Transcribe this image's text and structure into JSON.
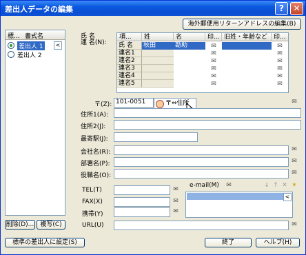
{
  "window": {
    "title": "差出人データの編集",
    "help_btn": "?",
    "close_btn": "✕"
  },
  "top_button": "海外郵便用リターンアドレスの編集(B)",
  "left_list": {
    "headers": [
      "標...",
      "書式名"
    ],
    "items": [
      {
        "label": "差出人 1",
        "selected": true
      },
      {
        "label": "差出人 2",
        "selected": false
      }
    ],
    "delete_btn": "削除(D)...",
    "copy_btn": "複写(C)"
  },
  "name_section": {
    "label_line1": "氏 名",
    "label_line2": "連 名(N):",
    "columns": [
      "項...",
      "姓",
      "名",
      "印...",
      "旧姓・年齢など",
      "印..."
    ],
    "rows": [
      {
        "item": "氏 名",
        "sei": "秋田",
        "mei": "勘助",
        "extra": ""
      },
      {
        "item": "連名1",
        "sei": "",
        "mei": "",
        "extra": ""
      },
      {
        "item": "連名2",
        "sei": "",
        "mei": "",
        "extra": ""
      },
      {
        "item": "連名3",
        "sei": "",
        "mei": "",
        "extra": ""
      },
      {
        "item": "連名4",
        "sei": "",
        "mei": "",
        "extra": ""
      },
      {
        "item": "連名5",
        "sei": "",
        "mei": "",
        "extra": ""
      }
    ]
  },
  "fields": {
    "postal_label": "〒(Z):",
    "postal_value": "101-0051",
    "postal_popup": "〒⇔住所",
    "address1_label": "住所1(A):",
    "address2_label": "住所2(J):",
    "station_label": "最寄駅(J):",
    "company_label": "会社名(R):",
    "department_label": "部署名(P):",
    "title_label": "役職名(O):",
    "tel_label": "TEL(T)",
    "fax_label": "FAX(X)",
    "mobile_label": "携帯(Y)",
    "url_label": "URL(U)",
    "email_label": "e-mail(M)"
  },
  "bottom": {
    "default_btn": "標準の差出人に設定(S)",
    "finish_btn": "終了",
    "help_btn": "ヘルプ(H)"
  },
  "icons": {
    "stamp": "printer-stamp-icon",
    "arrows": [
      "down-arrow-icon",
      "up-arrow-icon",
      "delete-x-icon",
      "add-star-icon"
    ]
  }
}
